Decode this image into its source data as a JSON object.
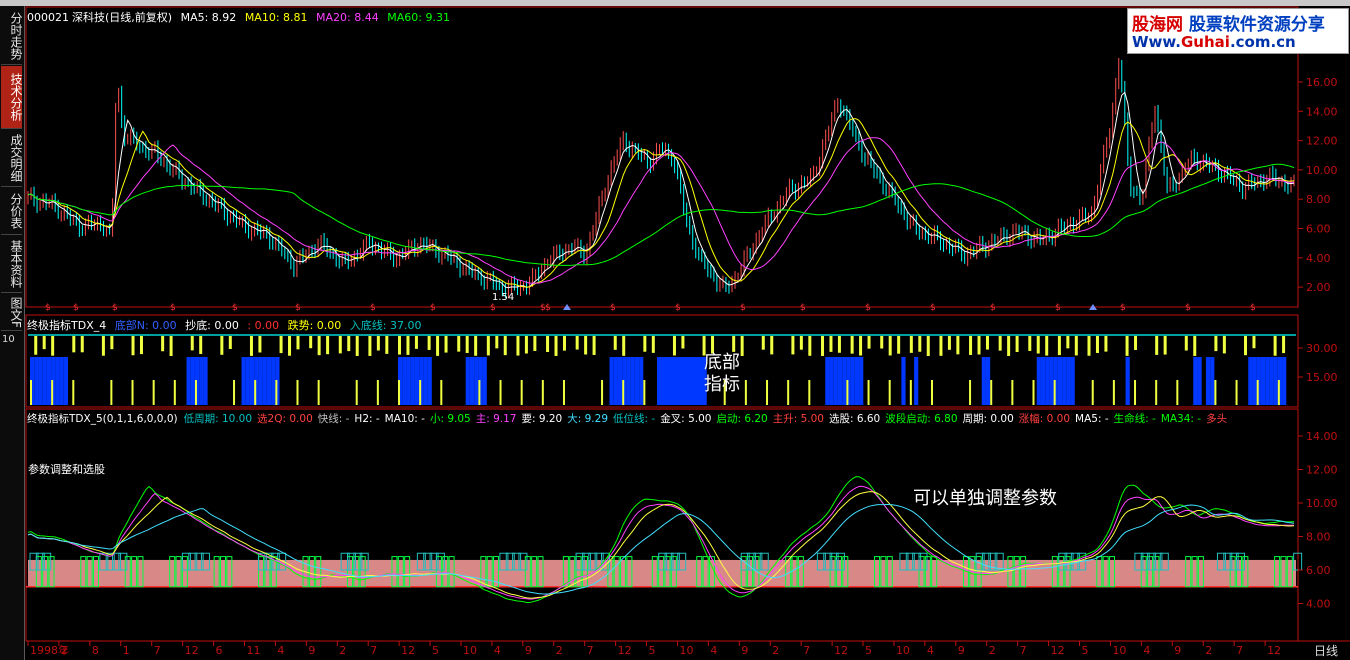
{
  "stock": {
    "code": "000021",
    "name": "深科技(日线,前复权)",
    "ma5": "MA5: 8.92",
    "ma10": "MA10: 8.81",
    "ma20": "MA20: 8.44",
    "ma60": "MA60: 9.31",
    "low_label": "1.54"
  },
  "sidebar": {
    "tabs": [
      {
        "label": "分时走势"
      },
      {
        "label": "技术分析"
      },
      {
        "label": "成交明细"
      },
      {
        "label": "分价表"
      },
      {
        "label": "基本资料"
      },
      {
        "label": "图文F"
      }
    ],
    "small": "10"
  },
  "indicator1": {
    "name": "终极指标TDX_4",
    "items": [
      "底部N: 0.00",
      "抄底: 0.00",
      ": 0.00",
      "跌势: 0.00",
      "入底线: 37.00"
    ],
    "annotation_line1": "底部",
    "annotation_line2": "指标"
  },
  "indicator2": {
    "name": "终极指标TDX_5(0,1,1,6,0,0,0)",
    "items": [
      "低周期: 10.00",
      "选2Q: 0.00",
      "快线: -",
      "H2: -",
      "MA10: -",
      "小: 9.05",
      "主: 9.17",
      "要: 9.20",
      "大: 9.29",
      "低位线: -",
      "金叉: 5.00",
      "启动: 6.20",
      "主升: 5.00",
      "选股: 6.60",
      "波段启动: 6.80",
      "周期: 0.00",
      "涨幅: 0.00",
      "MA5: -",
      "生命线: -",
      "MA34: -",
      "多头"
    ],
    "subtitle": "参数调整和选股",
    "annotation": "可以单独调整参数"
  },
  "price_axis": [
    "16.00",
    "14.00",
    "12.00",
    "10.00",
    "8.00",
    "6.00",
    "4.00",
    "2.00"
  ],
  "ind1_axis": [
    "30.00",
    "15.00"
  ],
  "ind2_axis": [
    "14.00",
    "12.00",
    "10.00",
    "8.00",
    "6.00",
    "4.00"
  ],
  "time_axis": [
    "1998年",
    "2",
    "8",
    "1",
    "7",
    "12",
    "6",
    "11",
    "4",
    "9",
    "2",
    "7",
    "12",
    "5",
    "10",
    "4",
    "9",
    "2",
    "7",
    "12",
    "5",
    "10",
    "4",
    "9",
    "2",
    "7",
    "12",
    "5",
    "10",
    "4",
    "9",
    "2",
    "7",
    "12",
    "5",
    "10",
    "4",
    "9",
    "2",
    "7",
    "12"
  ],
  "period": "日线",
  "logo": {
    "site_cn": "股海网",
    "tagline": "股票软件资源分享",
    "url_prefix": "Www.",
    "url_main": "Guhai",
    "url_suffix": ".com.cn"
  },
  "colors": {
    "up": "#ff5050",
    "down": "#00ffff",
    "ma5": "#ffffff",
    "ma10": "#ffff00",
    "ma20": "#ff40ff",
    "ma60": "#00ff00",
    "bar_yellow": "#f0ff40",
    "bar_blue": "#0038ff",
    "bar_teal": "#00a0a0",
    "pink_fill": "#ffa0a0",
    "axis": "#c01010"
  }
}
